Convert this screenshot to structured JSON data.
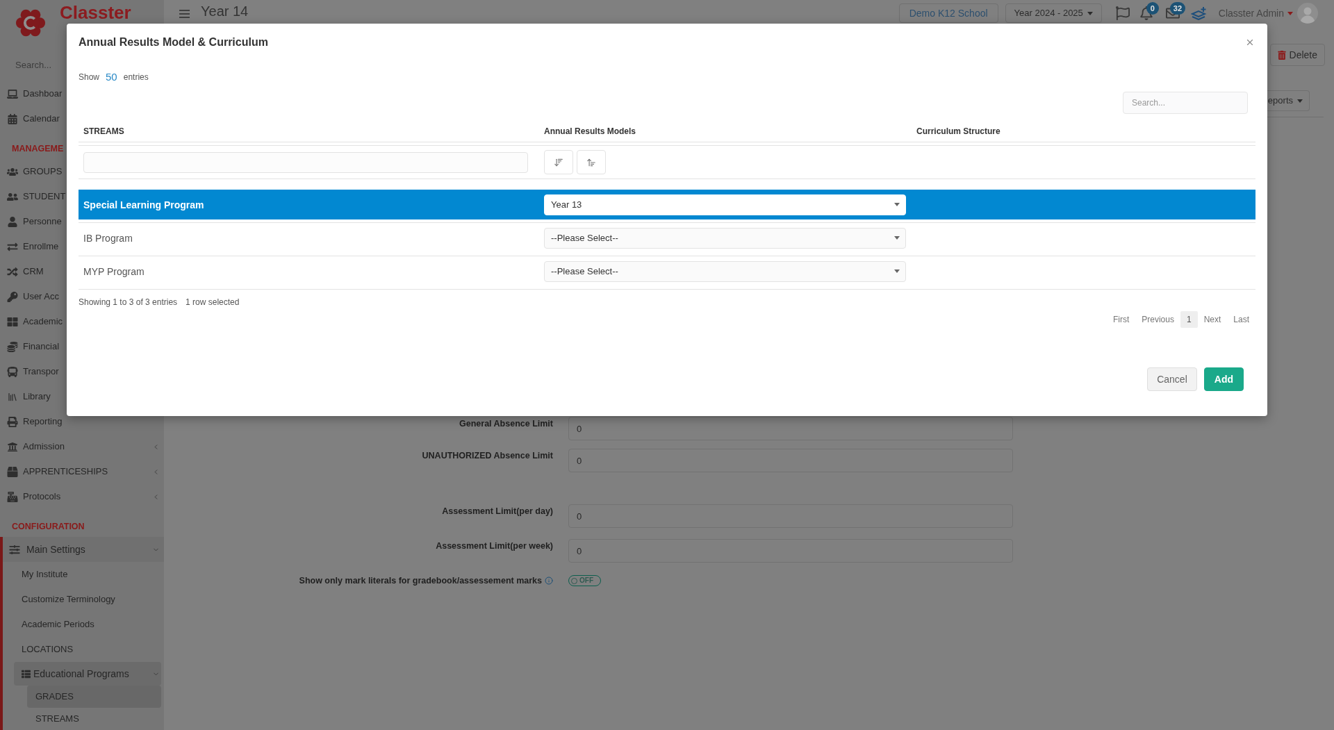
{
  "sidebar": {
    "logo_text": "Classter",
    "search": {
      "placeholder": "Search..."
    },
    "sections": [
      {
        "items": [
          {
            "label": "Dashboar",
            "selected": false
          },
          {
            "label": "Calendar",
            "selected": false
          }
        ]
      },
      {
        "title": "MANAGEME",
        "items": [
          {
            "label": "GROUPS",
            "selected": false
          },
          {
            "label": "STUDENT",
            "selected": false
          },
          {
            "label": "Personne",
            "selected": false
          },
          {
            "label": "Enrollme",
            "selected": false
          },
          {
            "label": "CRM",
            "selected": false
          },
          {
            "label": "User Acc",
            "selected": false
          },
          {
            "label": "Academic",
            "selected": false
          },
          {
            "label": "Financial",
            "selected": false
          },
          {
            "label": "Transpor",
            "selected": false
          },
          {
            "label": "Library",
            "selected": false
          },
          {
            "label": "Reporting",
            "selected": false
          },
          {
            "label": "Admission",
            "selected": false,
            "expanded": false
          },
          {
            "label": "APPRENTICESHIPS",
            "selected": false,
            "expanded": false
          },
          {
            "label": "Protocols",
            "selected": false,
            "expanded": false
          }
        ]
      },
      {
        "title": "CONFIGURATION",
        "items": [
          {
            "label": "Main Settings",
            "selected": false,
            "expanded": true,
            "children": [
              {
                "label": "My Institute",
                "selected": false
              },
              {
                "label": "Customize Terminology",
                "selected": false
              },
              {
                "label": "Academic Periods",
                "selected": false
              },
              {
                "label": "LOCATIONS",
                "selected": false
              },
              {
                "label": "Educational Programs",
                "selected": false,
                "expanded": true,
                "children": [
                  {
                    "label": "GRADES",
                    "selected": true
                  },
                  {
                    "label": "STREAMS",
                    "selected": false
                  }
                ]
              }
            ]
          }
        ]
      }
    ]
  },
  "header": {
    "title": "Year 14",
    "school_button": "Demo K12 School",
    "year_dropdown": "Year 2024 - 2025",
    "notification_count": "0",
    "message_count": "32",
    "user_name": "Classter Admin"
  },
  "toolbar": {
    "delete_button": "Delete",
    "reports_dropdown": "eports"
  },
  "form": {
    "fields": [
      {
        "label": "General Absence Limit",
        "value": "0"
      },
      {
        "label": "UNAUTHORIZED Absence Limit",
        "value": "0"
      },
      {
        "label": "Assessment Limit(per day)",
        "value": "0"
      },
      {
        "label": "Assessment Limit(per week)",
        "value": "0"
      }
    ],
    "toggle": {
      "label": "Show only mark literals for gradebook/assessement marks",
      "state_text": "OFF",
      "on": false
    }
  },
  "modal": {
    "title": "Annual Results Model & Curriculum",
    "length_menu": {
      "prefix": "Show",
      "value": "50",
      "suffix": "entries"
    },
    "search": {
      "placeholder": "Search..."
    },
    "table": {
      "columns": [
        "STREAMS",
        "Annual Results Models",
        "Curriculum Structure"
      ],
      "rows": [
        {
          "stream": "Special Learning Program",
          "annual_results_model": "Year 13",
          "selected": true
        },
        {
          "stream": "IB Program",
          "annual_results_model": "--Please Select--",
          "selected": false
        },
        {
          "stream": "MYP Program",
          "annual_results_model": "--Please Select--",
          "selected": false
        }
      ]
    },
    "info": "Showing 1 to 3 of 3 entries",
    "selection_info": "1 row selected",
    "pagination": [
      {
        "label": "First",
        "selected": false
      },
      {
        "label": "Previous",
        "selected": false
      },
      {
        "label": "1",
        "selected": true
      },
      {
        "label": "Next",
        "selected": false
      },
      {
        "label": "Last",
        "selected": false
      }
    ],
    "buttons": [
      {
        "label": "Cancel",
        "kind": "secondary"
      },
      {
        "label": "Add",
        "kind": "primary"
      }
    ]
  }
}
